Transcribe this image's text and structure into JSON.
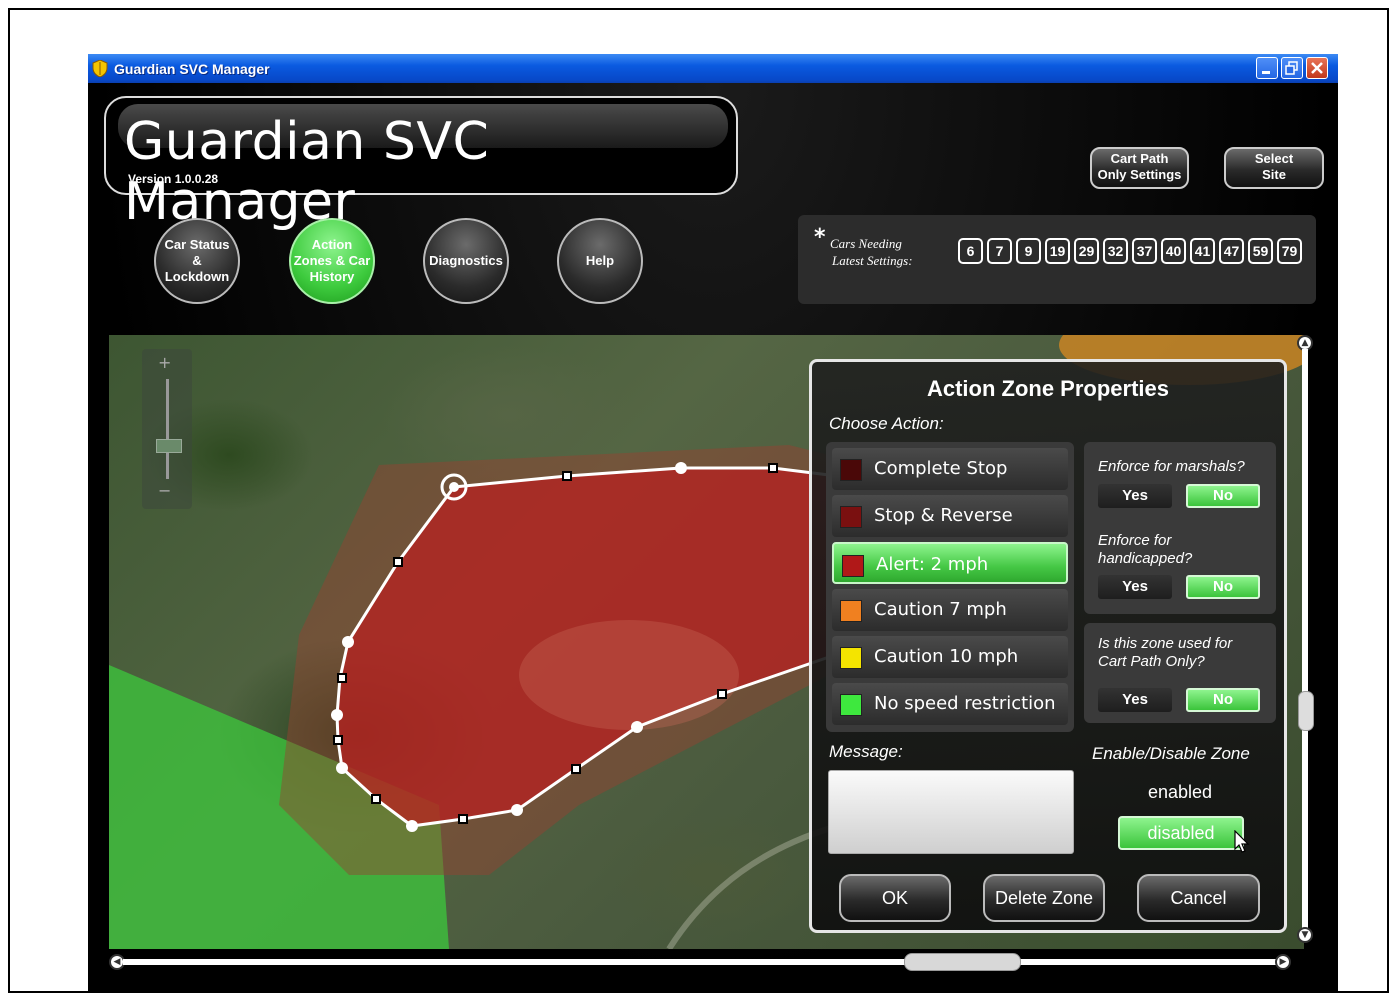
{
  "window": {
    "title": "Guardian SVC Manager"
  },
  "header": {
    "app_title": "Guardian SVC Manager",
    "version": "Version 1.0.0.28",
    "cart_path_btn": [
      "Cart Path",
      "Only Settings"
    ],
    "select_site_btn": [
      "Select",
      "Site"
    ]
  },
  "nav": [
    {
      "lines": [
        "Car Status",
        "&",
        "Lockdown"
      ],
      "active": false
    },
    {
      "lines": [
        "Action",
        "Zones & Car",
        "History"
      ],
      "active": true
    },
    {
      "lines": [
        "Diagnostics"
      ],
      "active": false
    },
    {
      "lines": [
        "Help"
      ],
      "active": false
    }
  ],
  "cars_needing": {
    "star": "*",
    "label_line1": "Cars Needing",
    "label_line2": "Latest Settings:",
    "cars": [
      "6",
      "7",
      "9",
      "19",
      "29",
      "32",
      "37",
      "40",
      "41",
      "47",
      "59",
      "79"
    ]
  },
  "map": {
    "zoom_plus": "+",
    "zoom_minus": "−"
  },
  "dialog": {
    "title": "Action Zone Properties",
    "choose_action": "Choose Action:",
    "actions": [
      {
        "label": "Complete Stop",
        "color": "#4a0808",
        "selected": false
      },
      {
        "label": "Stop & Reverse",
        "color": "#7a1010",
        "selected": false
      },
      {
        "label": "Alert: 2 mph",
        "color": "#b01818",
        "selected": true
      },
      {
        "label": "Caution 7 mph",
        "color": "#f08020",
        "selected": false
      },
      {
        "label": "Caution 10 mph",
        "color": "#f4e400",
        "selected": false
      },
      {
        "label": "No speed restriction",
        "color": "#3ee83e",
        "selected": false
      }
    ],
    "enforce_marshals": "Enforce for marshals?",
    "enforce_handicapped_l1": "Enforce for",
    "enforce_handicapped_l2": "handicapped?",
    "cart_path_only_l1": "Is this zone used for",
    "cart_path_only_l2": "Cart Path Only?",
    "yes": "Yes",
    "no": "No",
    "message_label": "Message:",
    "message_value": "",
    "enable_label": "Enable/Disable Zone",
    "enabled": "enabled",
    "disabled": "disabled",
    "ok": "OK",
    "delete": "Delete Zone",
    "cancel": "Cancel"
  }
}
